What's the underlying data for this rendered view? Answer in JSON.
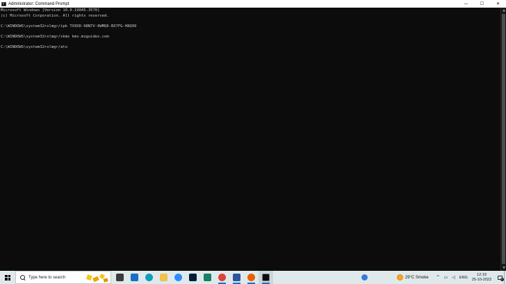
{
  "window": {
    "title": "Administrator: Command Prompt",
    "controls": {
      "minimize": "—",
      "maximize": "☐",
      "close": "✕"
    }
  },
  "console": {
    "lines": [
      "Microsoft Windows [Version 10.0.19045.3570]",
      "(c) Microsoft Corporation. All rights reserved.",
      "",
      "C:\\WINDOWS\\system32>slmgr/ipk TX9XD-98N7V-6WMQ6-BX7FG-H8Q99",
      "",
      "C:\\WINDOWS\\system32>slmgr/skms kms.msguides.com",
      "",
      "C:\\WINDOWS\\system32>slmgr/ato"
    ],
    "text_color": "#cccccc",
    "background": "#0c0c0c"
  },
  "taskbar": {
    "search_placeholder": "Type here to search",
    "apps": [
      {
        "name": "task-view-icon",
        "color": "#3b3b3b"
      },
      {
        "name": "mail-icon",
        "color": "#1b6ec2"
      },
      {
        "name": "edge-icon",
        "color": "#0f9dbd"
      },
      {
        "name": "file-explorer-icon",
        "color": "#f2c04d"
      },
      {
        "name": "zoom-icon",
        "color": "#2d8cff"
      },
      {
        "name": "photoshop-icon",
        "color": "#001e36"
      },
      {
        "name": "app-icon",
        "color": "#1a7f64"
      },
      {
        "name": "chrome-icon",
        "color": "#db4437"
      },
      {
        "name": "word-icon",
        "color": "#2b579a"
      },
      {
        "name": "firefox-icon",
        "color": "#e66000"
      },
      {
        "name": "command-prompt-icon",
        "color": "#0c0c0c"
      }
    ],
    "weather": "29°C  Smoke",
    "language": "ENG",
    "time": "12:19",
    "date": "25-10-2023",
    "notification_count": "1"
  }
}
